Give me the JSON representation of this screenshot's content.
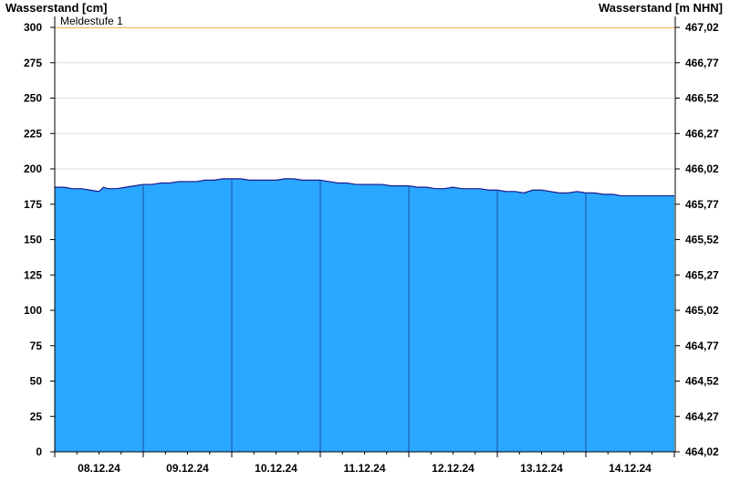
{
  "chart_data": {
    "type": "area",
    "ylabel_left": "Wasserstand [cm]",
    "ylabel_right": "Wasserstand [m NHN]",
    "ylim": [
      0,
      300
    ],
    "y_ticks_left": [
      "0",
      "25",
      "50",
      "75",
      "100",
      "125",
      "150",
      "175",
      "200",
      "225",
      "250",
      "275",
      "300"
    ],
    "y_ticks_right": [
      "464,02",
      "464,27",
      "464,52",
      "464,77",
      "465,02",
      "465,27",
      "465,52",
      "465,77",
      "466,02",
      "466,27",
      "466,52",
      "466,77",
      "467,02"
    ],
    "x_tick_labels": [
      "08.12.24",
      "09.12.24",
      "10.12.24",
      "11.12.24",
      "12.12.24",
      "13.12.24",
      "14.12.24"
    ],
    "x_range_days": [
      0,
      7
    ],
    "threshold": {
      "label": "Meldestufe 1",
      "value": 300,
      "color": "#f2c14e"
    },
    "fill_color": "#2aa7ff",
    "line_color": "#1a1a8c",
    "grid": true,
    "series": [
      {
        "x": [
          0,
          0.1,
          0.2,
          0.3,
          0.4,
          0.5,
          0.55,
          0.6,
          0.7,
          0.8,
          0.9,
          1.0,
          1.1,
          1.2,
          1.3,
          1.4,
          1.5,
          1.6,
          1.7,
          1.8,
          1.9,
          2.0,
          2.1,
          2.2,
          2.3,
          2.4,
          2.5,
          2.6,
          2.7,
          2.8,
          2.9,
          3.0,
          3.1,
          3.2,
          3.3,
          3.4,
          3.5,
          3.6,
          3.7,
          3.8,
          3.9,
          4.0,
          4.1,
          4.2,
          4.3,
          4.4,
          4.5,
          4.6,
          4.7,
          4.8,
          4.9,
          5.0,
          5.1,
          5.2,
          5.3,
          5.4,
          5.5,
          5.6,
          5.7,
          5.8,
          5.9,
          6.0,
          6.1,
          6.2,
          6.3,
          6.4,
          6.5,
          6.6,
          6.7,
          6.8,
          6.9,
          7.0
        ],
        "y": [
          187,
          187,
          186,
          186,
          185,
          184,
          187,
          186,
          186,
          187,
          188,
          189,
          189,
          190,
          190,
          191,
          191,
          191,
          192,
          192,
          193,
          193,
          193,
          192,
          192,
          192,
          192,
          193,
          193,
          192,
          192,
          192,
          191,
          190,
          190,
          189,
          189,
          189,
          189,
          188,
          188,
          188,
          187,
          187,
          186,
          186,
          187,
          186,
          186,
          186,
          185,
          185,
          184,
          184,
          183,
          185,
          185,
          184,
          183,
          183,
          184,
          183,
          183,
          182,
          182,
          181,
          181,
          181,
          181,
          181,
          181,
          181
        ]
      }
    ]
  }
}
